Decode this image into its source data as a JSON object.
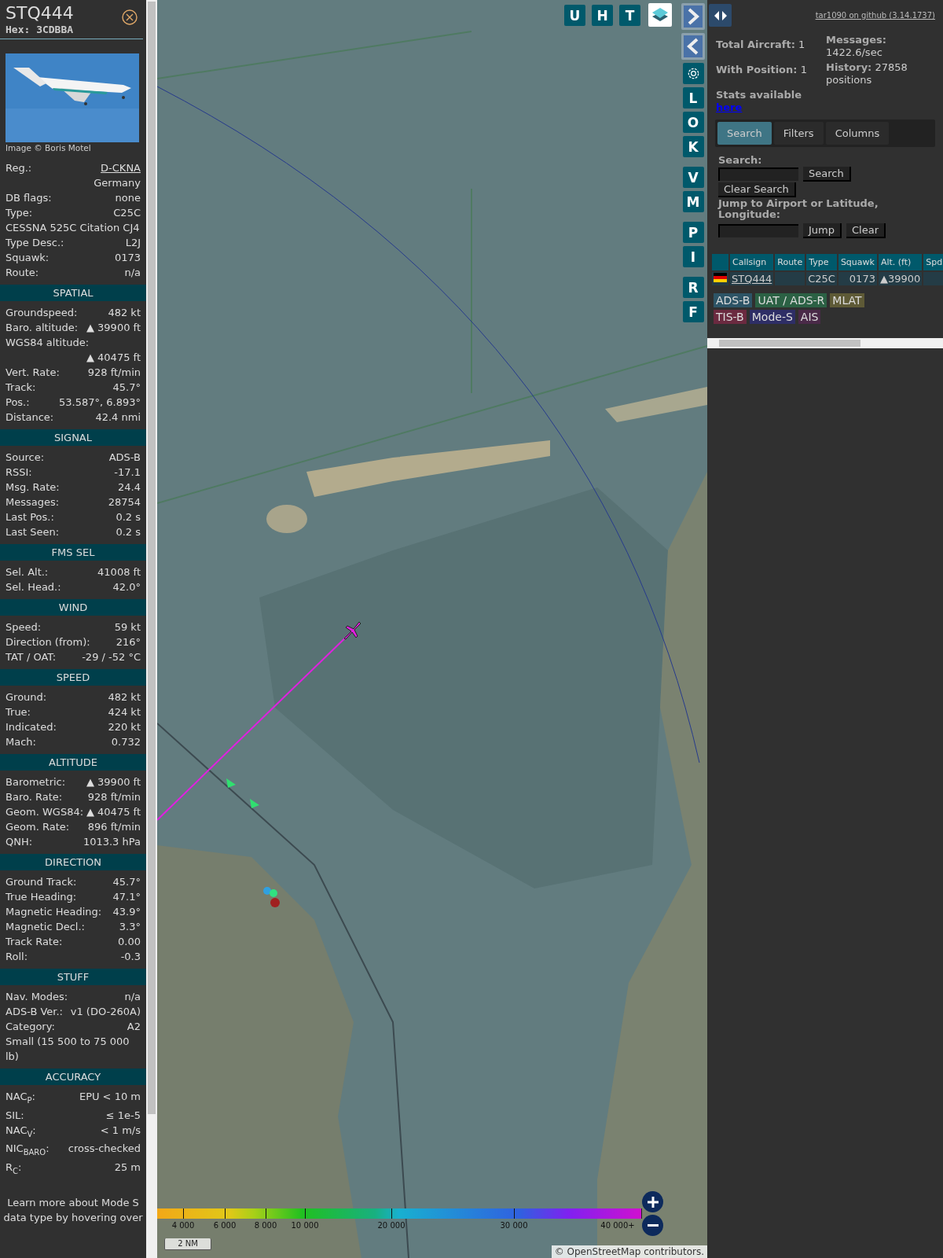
{
  "sidebar": {
    "callsign": "STQ444",
    "hex": "Hex: 3CDBBA",
    "photo": {
      "kind": "picture"
    },
    "photo_credit": "Image © Boris Motel",
    "info": [
      {
        "kind": "link",
        "label": "Reg.:",
        "value": "D-CKNA"
      },
      {
        "kind": "value",
        "value": "Germany"
      },
      {
        "kind": "pair",
        "label": "DB flags:",
        "value": "none"
      },
      {
        "kind": "pair",
        "label": "Type:",
        "value": "C25C"
      },
      {
        "kind": "text",
        "value": "CESSNA 525C Citation CJ4"
      },
      {
        "kind": "pair",
        "label": "Type Desc.:",
        "value": "L2J"
      },
      {
        "kind": "pair",
        "label": "Squawk:",
        "value": "0173"
      },
      {
        "kind": "pair",
        "label": "Route:",
        "value": "n/a"
      }
    ],
    "sections": [
      {
        "title": "SPATIAL",
        "rows": [
          {
            "kind": "pair",
            "label": "Groundspeed:",
            "value": "482 kt"
          },
          {
            "kind": "pair",
            "label": "Baro. altitude:",
            "value": "▲ 39900 ft"
          },
          {
            "kind": "text",
            "value": "WGS84 altitude:"
          },
          {
            "kind": "value",
            "value": "▲ 40475 ft"
          },
          {
            "kind": "pair",
            "label": "Vert. Rate:",
            "value": "928 ft/min"
          },
          {
            "kind": "pair",
            "label": "Track:",
            "value": "45.7°"
          },
          {
            "kind": "pair",
            "label": "Pos.:",
            "value": "53.587°, 6.893°"
          },
          {
            "kind": "pair",
            "label": "Distance:",
            "value": "42.4 nmi"
          }
        ]
      },
      {
        "title": "SIGNAL",
        "rows": [
          {
            "kind": "pair",
            "label": "Source:",
            "value": "ADS-B"
          },
          {
            "kind": "pair",
            "label": "RSSI:",
            "value": "-17.1"
          },
          {
            "kind": "pair",
            "label": "Msg. Rate:",
            "value": "24.4"
          },
          {
            "kind": "pair",
            "label": "Messages:",
            "value": "28754"
          },
          {
            "kind": "pair",
            "label": "Last Pos.:",
            "value": "0.2 s"
          },
          {
            "kind": "pair",
            "label": "Last Seen:",
            "value": "0.2 s"
          }
        ]
      },
      {
        "title": "FMS SEL",
        "rows": [
          {
            "kind": "pair",
            "label": "Sel. Alt.:",
            "value": "41008 ft"
          },
          {
            "kind": "pair",
            "label": "Sel. Head.:",
            "value": "42.0°"
          }
        ]
      },
      {
        "title": "WIND",
        "rows": [
          {
            "kind": "pair",
            "label": "Speed:",
            "value": "59 kt"
          },
          {
            "kind": "pair",
            "label": "Direction (from):",
            "value": "216°"
          },
          {
            "kind": "pair",
            "label": "TAT / OAT:",
            "value": "-29 / -52 °C"
          }
        ]
      },
      {
        "title": "SPEED",
        "rows": [
          {
            "kind": "pair",
            "label": "Ground:",
            "value": "482 kt"
          },
          {
            "kind": "pair",
            "label": "True:",
            "value": "424 kt"
          },
          {
            "kind": "pair",
            "label": "Indicated:",
            "value": "220 kt"
          },
          {
            "kind": "pair",
            "label": "Mach:",
            "value": "0.732"
          }
        ]
      },
      {
        "title": "ALTITUDE",
        "rows": [
          {
            "kind": "pair",
            "label": "Barometric:",
            "value": "▲ 39900 ft"
          },
          {
            "kind": "pair",
            "label": "Baro. Rate:",
            "value": "928 ft/min"
          },
          {
            "kind": "pair",
            "label": "Geom. WGS84:",
            "value": "▲ 40475 ft"
          },
          {
            "kind": "pair",
            "label": "Geom. Rate:",
            "value": "896 ft/min"
          },
          {
            "kind": "pair",
            "label": "QNH:",
            "value": "1013.3 hPa"
          }
        ]
      },
      {
        "title": "DIRECTION",
        "rows": [
          {
            "kind": "pair",
            "label": "Ground Track:",
            "value": "45.7°"
          },
          {
            "kind": "pair",
            "label": "True Heading:",
            "value": "47.1°"
          },
          {
            "kind": "pair",
            "label": "Magnetic Heading:",
            "value": "43.9°"
          },
          {
            "kind": "pair",
            "label": "Magnetic Decl.:",
            "value": "3.3°"
          },
          {
            "kind": "pair",
            "label": "Track Rate:",
            "value": "0.00"
          },
          {
            "kind": "pair",
            "label": "Roll:",
            "value": "-0.3"
          }
        ]
      },
      {
        "title": "STUFF",
        "rows": [
          {
            "kind": "pair",
            "label": "Nav. Modes:",
            "value": "n/a"
          },
          {
            "kind": "pair",
            "label": "ADS-B Ver.:",
            "value": "v1 (DO-260A)"
          },
          {
            "kind": "pair",
            "label": "Category:",
            "value": "A2"
          },
          {
            "kind": "text",
            "value": "Small (15 500 to 75 000 lb)"
          }
        ]
      },
      {
        "title": "ACCURACY",
        "rows": [
          {
            "kind": "pair",
            "label": "NAC$_{P}$:",
            "value": "EPU < 10 m"
          },
          {
            "kind": "pair",
            "label": "SIL:",
            "value": "≤ 1e-5"
          },
          {
            "kind": "pair",
            "label": "NAC$_{V}$:",
            "value": "< 1 m/s"
          },
          {
            "kind": "pair",
            "label": "NIC$_{BARO}$:",
            "value": "cross-checked"
          },
          {
            "kind": "pair",
            "label": "R$_{C}$:",
            "value": "25 m"
          }
        ]
      }
    ],
    "footer": "Learn more about Mode S data type by hovering over"
  },
  "map": {
    "picture": {
      "kind": "picture"
    },
    "top_buttons": [
      {
        "kind": "letter",
        "label": "U"
      },
      {
        "kind": "letter",
        "label": "H"
      },
      {
        "kind": "letter",
        "label": "T"
      },
      {
        "kind": "layers"
      }
    ],
    "side_groups": [
      [
        {
          "kind": "next"
        },
        {
          "kind": "prev"
        },
        {
          "kind": "settings"
        },
        {
          "kind": "letter",
          "label": "L"
        },
        {
          "kind": "letter",
          "label": "O"
        },
        {
          "kind": "letter",
          "label": "K"
        }
      ],
      [
        {
          "kind": "letter",
          "label": "V"
        },
        {
          "kind": "letter",
          "label": "M"
        }
      ],
      [
        {
          "kind": "letter",
          "label": "P"
        },
        {
          "kind": "letter",
          "label": "I"
        }
      ],
      [
        {
          "kind": "letter",
          "label": "R"
        },
        {
          "kind": "letter",
          "label": "F"
        }
      ]
    ],
    "legend_labels": [
      "4 000",
      "6 000",
      "8 000",
      "10 000",
      "20 000",
      "30 000",
      "40 000+"
    ],
    "scale": "2 NM",
    "attribution": "© OpenStreetMap contributors."
  },
  "panel": {
    "github_link": "tar1090 on github (3.14.1737)",
    "stats_left": [
      {
        "label": "Total Aircraft:",
        "value": "1"
      },
      {
        "label": "With Position:",
        "value": "1"
      }
    ],
    "stats_available": "Stats available",
    "stats_link": "here",
    "stats_right": [
      {
        "label": "Messages:",
        "value": "1422.6/sec"
      },
      {
        "label": "History:",
        "value": "27858 positions"
      }
    ],
    "tabs": [
      {
        "label": "Search",
        "selected": true
      },
      {
        "label": "Filters",
        "selected": false
      },
      {
        "label": "Columns",
        "selected": false
      }
    ],
    "search_label": "Search:",
    "search_button": "Search",
    "clear_search_button": "Clear Search",
    "jump_label": "Jump to Airport or Latitude, Longitude:",
    "jump_button": "Jump",
    "clear_button": "Clear",
    "table": {
      "columns": [
        "",
        "Callsign",
        "Route",
        "Type",
        "Squawk",
        "Alt. (ft)",
        "Spd"
      ],
      "rows": [
        {
          "callsign": "STQ444",
          "route": "",
          "type": "C25C",
          "squawk": "0173",
          "altitude": "▲39900",
          "speed": ""
        }
      ]
    },
    "legend": [
      {
        "label": "ADS-B",
        "color": "#2d5466"
      },
      {
        "label": "UAT / ADS-R",
        "color": "#2b6144"
      },
      {
        "label": "MLAT",
        "color": "#5e5a36"
      },
      {
        "label": "TIS-B",
        "color": "#6b2a40"
      },
      {
        "label": "Mode-S",
        "color": "#2e2e66"
      },
      {
        "label": "AIS",
        "color": "#4a2a48"
      }
    ]
  }
}
